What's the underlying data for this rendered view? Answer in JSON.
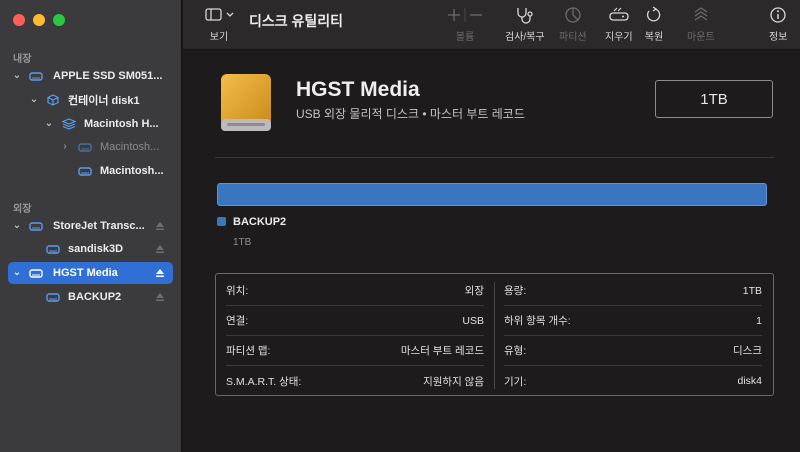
{
  "sidebar": {
    "internal_label": "내장",
    "external_label": "외장",
    "items": [
      {
        "label": "APPLE SSD SM051..."
      },
      {
        "label": "컨테이너 disk1"
      },
      {
        "label": "Macintosh H..."
      },
      {
        "label": "Macintosh..."
      },
      {
        "label": "Macintosh..."
      },
      {
        "label": "StoreJet Transc..."
      },
      {
        "label": "sandisk3D"
      },
      {
        "label": "HGST Media"
      },
      {
        "label": "BACKUP2"
      }
    ]
  },
  "toolbar": {
    "view_label": "보기",
    "title": "디스크 유틸리티",
    "volume_label": "볼륨",
    "firstaid_label": "검사/복구",
    "partition_label": "파티션",
    "erase_label": "지우기",
    "restore_label": "복원",
    "mount_label": "마운트",
    "info_label": "정보"
  },
  "disk": {
    "name": "HGST Media",
    "subtitle": "USB 외장 물리적 디스크 • 마스터 부트 레코드",
    "size": "1TB"
  },
  "partition": {
    "name": "BACKUP2",
    "size": "1TB",
    "color": "#3a76c0",
    "fill_fraction": 1.0
  },
  "info": {
    "left": [
      {
        "label": "위치:",
        "value": "외장"
      },
      {
        "label": "연결:",
        "value": "USB"
      },
      {
        "label": "파티션 맵:",
        "value": "마스터 부트 레코드"
      },
      {
        "label": "S.M.A.R.T. 상태:",
        "value": "지원하지 않음"
      }
    ],
    "right": [
      {
        "label": "용량:",
        "value": "1TB"
      },
      {
        "label": "하위 항목 개수:",
        "value": "1"
      },
      {
        "label": "유형:",
        "value": "디스크"
      },
      {
        "label": "기기:",
        "value": "disk4"
      }
    ]
  },
  "colors": {
    "accent": "#2f6fd6",
    "drive_icon": "#e3a72f"
  }
}
